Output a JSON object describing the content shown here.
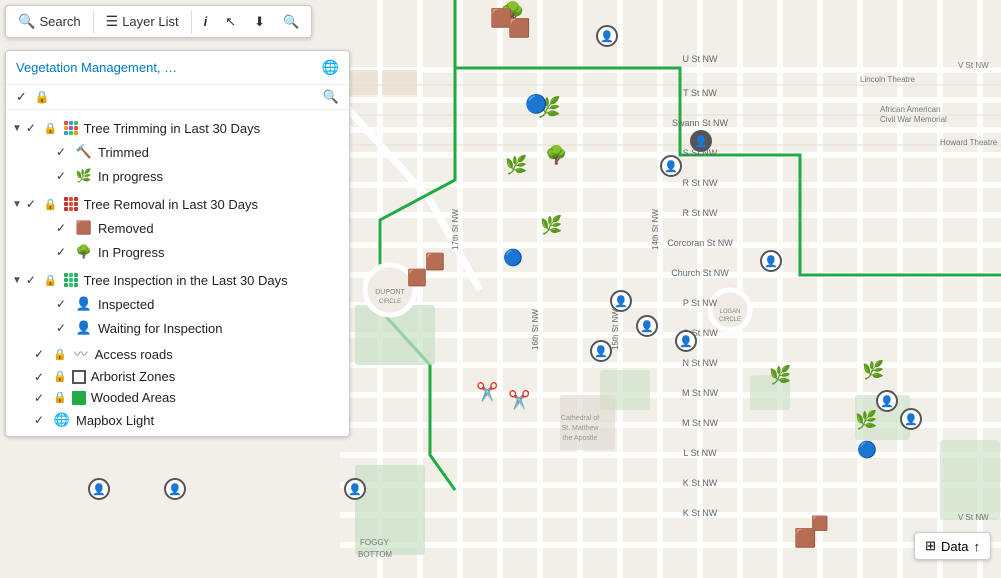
{
  "toolbar": {
    "search_label": "Search",
    "layer_list_label": "Layer List",
    "info_label": "i",
    "select_label": "▲",
    "download_label": "⬇",
    "zoom_label": "🔍"
  },
  "panel": {
    "title": "Vegetation Management, …",
    "globe_icon": "🌐",
    "search_icon": "🔍"
  },
  "layers": [
    {
      "id": "tree-trimming",
      "label": "Tree Trimming in Last 30 Days",
      "checked": true,
      "locked": true,
      "expanded": true,
      "icon_type": "grid",
      "grid_class": "trimming-grid",
      "sublayers": [
        {
          "label": "Trimmed",
          "checked": true,
          "icon": "🔨"
        },
        {
          "label": "In progress",
          "checked": true,
          "icon": "🌿"
        }
      ]
    },
    {
      "id": "tree-removal",
      "label": "Tree Removal in Last 30 Days",
      "checked": true,
      "locked": true,
      "expanded": true,
      "icon_type": "grid",
      "grid_class": "removal-grid",
      "sublayers": [
        {
          "label": "Removed",
          "checked": true,
          "icon": "🟫"
        },
        {
          "label": "In Progress",
          "checked": true,
          "icon": "🌳"
        }
      ]
    },
    {
      "id": "tree-inspection",
      "label": "Tree Inspection in the Last 30 Days",
      "checked": true,
      "locked": true,
      "expanded": true,
      "icon_type": "grid",
      "grid_class": "inspection-grid",
      "sublayers": [
        {
          "label": "Inspected",
          "checked": true,
          "icon": "👤"
        },
        {
          "label": "Waiting for Inspection",
          "checked": true,
          "icon": "👤"
        }
      ]
    },
    {
      "id": "access-roads",
      "label": "Access roads",
      "checked": true,
      "locked": true,
      "icon": "〰"
    },
    {
      "id": "arborist-zones",
      "label": "Arborist Zones",
      "checked": true,
      "locked": true,
      "icon": "⬜"
    },
    {
      "id": "wooded-areas",
      "label": "Wooded Areas",
      "checked": true,
      "locked": true,
      "icon": "🟩"
    },
    {
      "id": "mapbox-light",
      "label": "Mapbox Light",
      "checked": true,
      "locked": false,
      "icon": "🌐"
    }
  ],
  "data_button": {
    "label": "Data",
    "icon": "⊞",
    "upload_icon": "↑"
  },
  "map": {
    "street_color": "#e8e0d0",
    "road_color": "#fff",
    "park_color": "#d5e8d4",
    "water_color": "#a8d4e6",
    "green_route_color": "#22aa44"
  }
}
